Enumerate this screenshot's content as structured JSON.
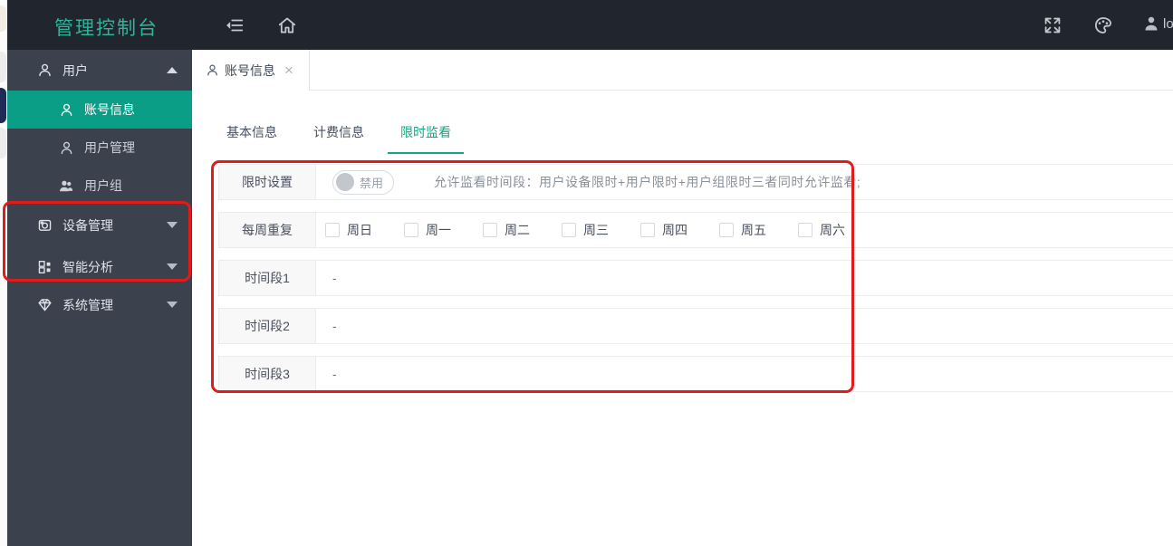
{
  "topbar": {
    "title": "管理控制台",
    "username": "lo",
    "icons": {
      "menu_fold": "menu-fold-icon",
      "home": "home-icon",
      "fullscreen": "fullscreen-icon",
      "theme_palette": "palette-icon",
      "user": "user-icon"
    }
  },
  "sidebar": {
    "items": [
      {
        "label": "用户",
        "icon": "user-outline",
        "expanded": true
      },
      {
        "label": "账号信息",
        "icon": "person-outline",
        "active": true
      },
      {
        "label": "用户管理",
        "icon": "person-outline"
      },
      {
        "label": "用户组",
        "icon": "people-solid"
      },
      {
        "label": "设备管理",
        "icon": "camera",
        "collapsed": true
      },
      {
        "label": "智能分析",
        "icon": "components-grid",
        "collapsed": true
      },
      {
        "label": "系统管理",
        "icon": "gem",
        "collapsed": true
      }
    ]
  },
  "page_tab": {
    "label": "账号信息",
    "close_glyph": "×"
  },
  "subtabs": {
    "items": [
      {
        "label": "基本信息",
        "active": false
      },
      {
        "label": "计费信息",
        "active": false
      },
      {
        "label": "限时监看",
        "active": true
      }
    ]
  },
  "form": {
    "rows": [
      {
        "label": "限时设置",
        "switch": {
          "state": "off",
          "text": "禁用"
        },
        "help": "允许监看时间段：用户设备限时+用户限时+用户组限时三者同时允许监看;"
      },
      {
        "label": "每周重复",
        "days": [
          "周日",
          "周一",
          "周二",
          "周三",
          "周四",
          "周五",
          "周六"
        ],
        "days_checked": [
          false,
          false,
          false,
          false,
          false,
          false,
          false
        ]
      },
      {
        "label": "时间段1",
        "value": "-"
      },
      {
        "label": "时间段2",
        "value": "-"
      },
      {
        "label": "时间段3",
        "value": "-"
      }
    ]
  },
  "annotations": {
    "color": "#e31a1a",
    "regions": [
      "sidebar-device-and-ai-menus",
      "limit-watch-form"
    ]
  },
  "colors": {
    "topbar_bg": "#21262e",
    "sidebar_bg": "#3b424e",
    "accent_teal": "#0a9e87",
    "title_teal": "#28b79a",
    "subtab_active": "#14a783",
    "annotation_red": "#e31a1a"
  }
}
